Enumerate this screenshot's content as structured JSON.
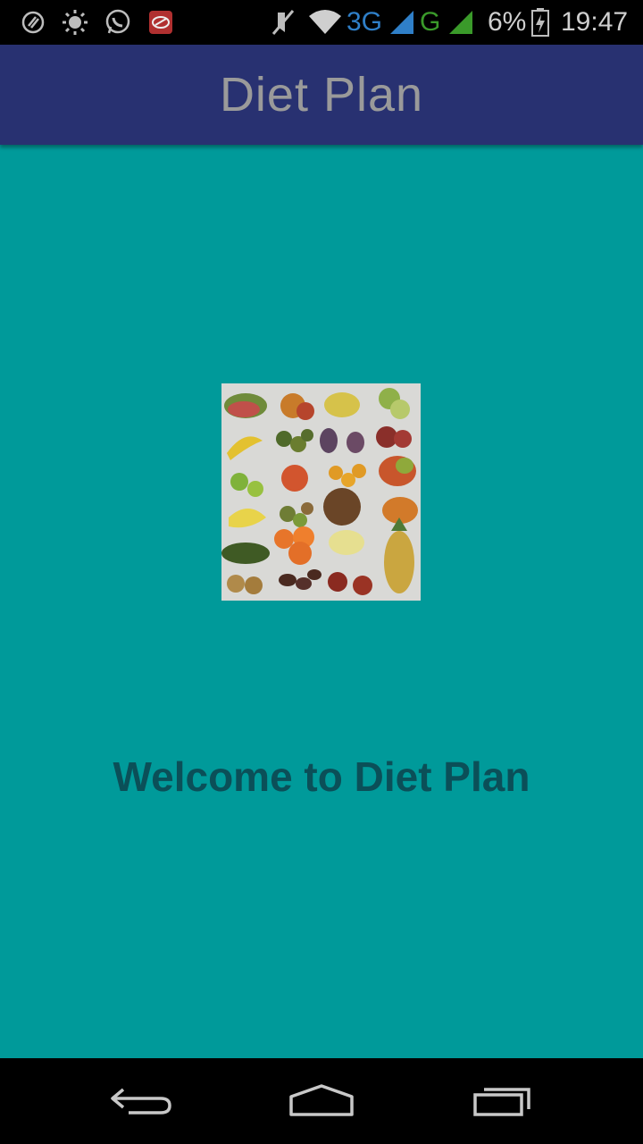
{
  "status_bar": {
    "network_3g": "3G",
    "network_g": "G",
    "battery_percent": "6%",
    "time": "19:47",
    "icons": [
      "nfc-icon",
      "brightness-icon",
      "whatsapp-icon",
      "notification-app-icon",
      "mute-icon",
      "wifi-icon",
      "signal-3g-icon",
      "signal-g-icon",
      "battery-charging-icon"
    ]
  },
  "action_bar": {
    "title": "Diet Plan"
  },
  "main": {
    "image_icon": "fruit-collage-image",
    "welcome_text": "Welcome to Diet Plan"
  },
  "nav_bar": {
    "icons": [
      "back-icon",
      "home-icon",
      "recents-icon"
    ]
  },
  "colors": {
    "action_bar": "#283171",
    "content_bg": "#009a9a",
    "welcome_text": "#0b4f58",
    "title_text": "#9a9a9a"
  }
}
